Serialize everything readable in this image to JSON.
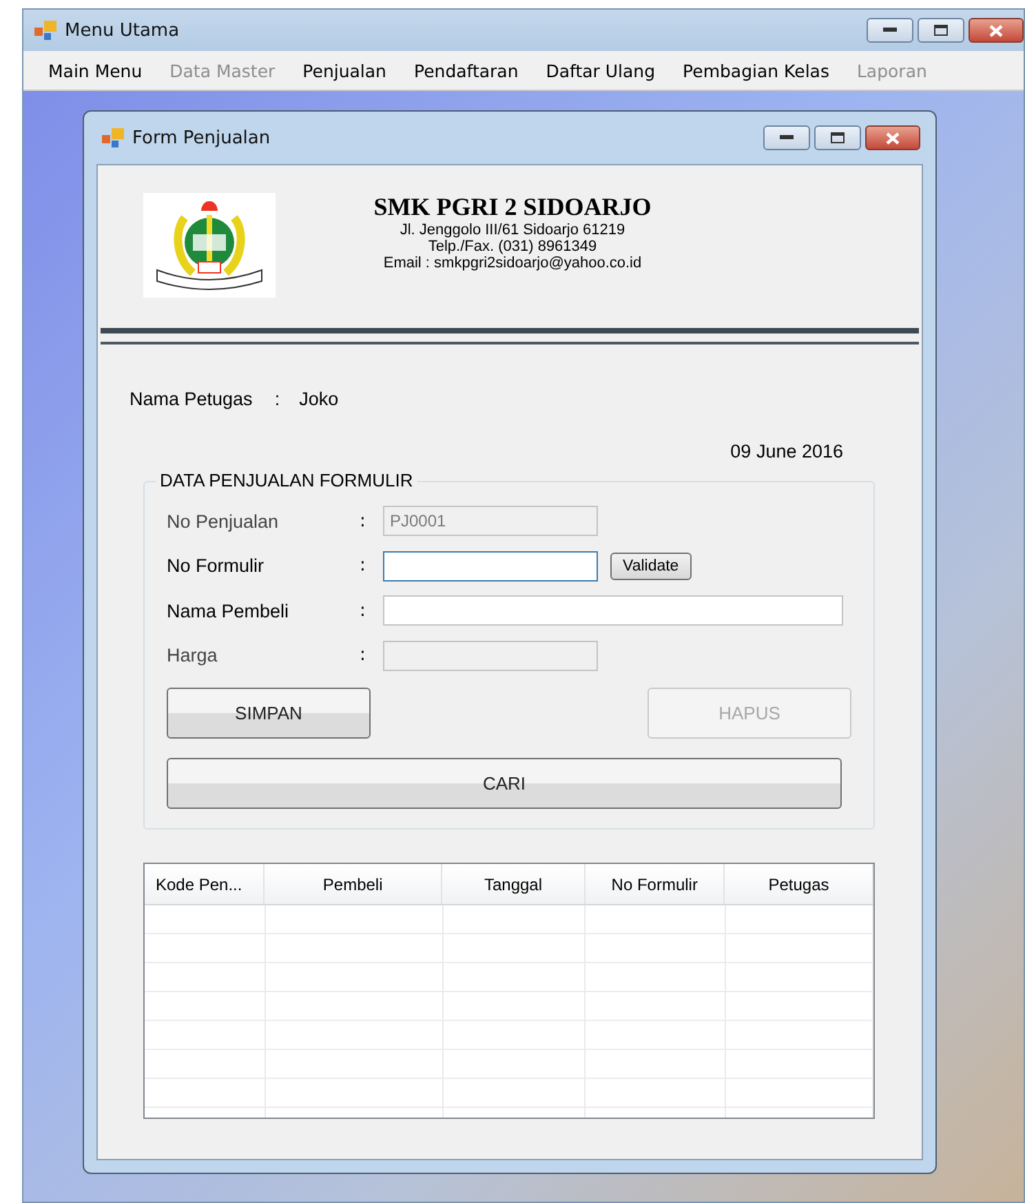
{
  "window": {
    "title": "Menu Utama"
  },
  "menu": [
    {
      "label": "Main Menu",
      "disabled": false
    },
    {
      "label": "Data Master",
      "disabled": true
    },
    {
      "label": "Penjualan",
      "disabled": false
    },
    {
      "label": "Pendaftaran",
      "disabled": false
    },
    {
      "label": "Daftar Ulang",
      "disabled": false
    },
    {
      "label": "Pembagian Kelas",
      "disabled": false
    },
    {
      "label": "Laporan",
      "disabled": true
    }
  ],
  "form": {
    "title": "Form Penjualan",
    "header": {
      "school": "SMK PGRI 2 SIDOARJO",
      "address": "Jl. Jenggolo III/61 Sidoarjo 61219",
      "phone": "Telp./Fax. (031) 8961349",
      "email": "Email : smkpgri2sidoarjo@yahoo.co.id"
    },
    "officer": {
      "label": "Nama Petugas",
      "separator": ":",
      "value": "Joko"
    },
    "date": "09 June 2016",
    "group": {
      "title": "DATA PENJUALAN FORMULIR",
      "fields": [
        {
          "label": "No Penjualan",
          "separator": ":",
          "value": "PJ0001",
          "disabled": true,
          "focused": false,
          "wide": false
        },
        {
          "label": "No Formulir",
          "separator": ":",
          "disabled": false,
          "focused": true,
          "wide": false,
          "button": "Validate"
        },
        {
          "label": "Nama Pembeli",
          "separator": ":",
          "disabled": false,
          "focused": false,
          "wide": true
        },
        {
          "label": "Harga",
          "separator": ":",
          "disabled": true,
          "focused": false,
          "wide": false
        }
      ],
      "buttons": [
        {
          "label": "SIMPAN",
          "disabled": false
        },
        {
          "label": "HAPUS",
          "disabled": true
        }
      ],
      "search_button": {
        "label": "CARI",
        "disabled": false
      }
    },
    "table": {
      "columns": [
        "Kode Pen...",
        "Pembeli",
        "Tanggal",
        "No Formulir",
        "Petugas"
      ]
    }
  }
}
